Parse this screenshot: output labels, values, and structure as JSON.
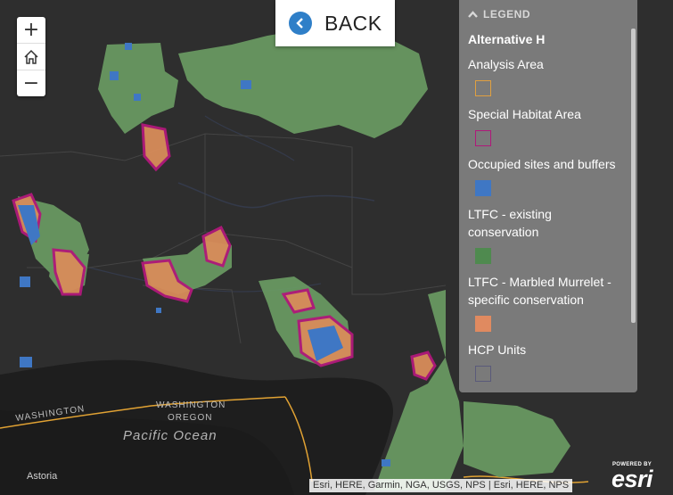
{
  "map": {
    "labels": {
      "washington_west": "WASHINGTON",
      "washington_center": "WASHINGTON",
      "oregon": "OREGON",
      "ocean": "Pacific Ocean",
      "astoria": "Astoria"
    }
  },
  "zoom": {
    "in_icon": "plus-icon",
    "home_icon": "home-icon",
    "out_icon": "minus-icon"
  },
  "back": {
    "label": "BACK",
    "icon": "chevron-left-icon"
  },
  "legend": {
    "header": "LEGEND",
    "layer_title": "Alternative H",
    "items": [
      {
        "label": "Analysis Area",
        "fill": "none",
        "stroke": "#e0a040"
      },
      {
        "label": "Special Habitat Area",
        "fill": "none",
        "stroke": "#b0187a"
      },
      {
        "label": "Occupied sites and buffers",
        "fill": "#3f77c4",
        "stroke": "#3f77c4"
      },
      {
        "label": "LTFC - existing conservation",
        "fill": "#4f8a4f",
        "stroke": "#4f8a4f"
      },
      {
        "label": "LTFC - Marbled Murrelet - specific conservation",
        "fill": "#e08a60",
        "stroke": "#e08a60"
      },
      {
        "label": "HCP Units",
        "fill": "none",
        "stroke": "#5a5a7a"
      }
    ]
  },
  "attribution": "Esri, HERE, Garmin, NGA, USGS, NPS | Esri, HERE, NPS",
  "logo": {
    "powered": "POWERED BY",
    "brand": "esri"
  }
}
